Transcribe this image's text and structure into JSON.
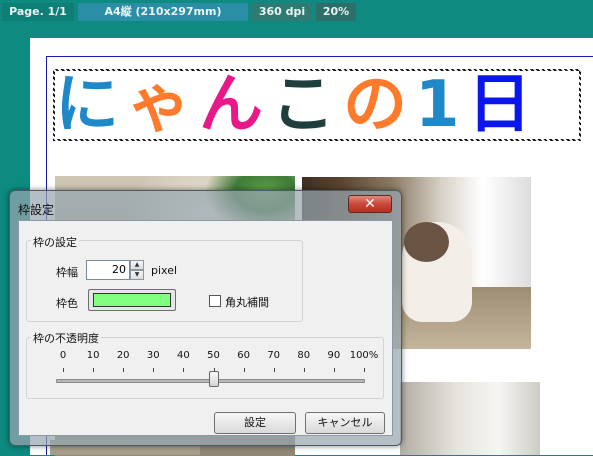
{
  "status_bar": {
    "page": "Page. 1/1",
    "paper": "A4縦 (210x297mm)",
    "dpi": "360 dpi",
    "zoom": "20%"
  },
  "document": {
    "title_chars": [
      {
        "char": "に",
        "color": "#1e88c8"
      },
      {
        "char": "ゃ",
        "color": "#ff7a2a"
      },
      {
        "char": "ん",
        "color": "#e8178a"
      },
      {
        "char": "こ",
        "color": "#1f3f3f"
      },
      {
        "char": "の",
        "color": "#ff7a2a"
      },
      {
        "char": "1",
        "color": "#1e88c8"
      },
      {
        "char": "日",
        "color": "#0b16ee"
      }
    ]
  },
  "dialog": {
    "title": "枠設定",
    "close_label": "✕",
    "frame_group": {
      "label": "枠の設定",
      "width_label": "枠幅",
      "width_value": "20",
      "width_unit": "pixel",
      "color_label": "枠色",
      "color_value": "#80ff80",
      "rounded_label": "角丸補間",
      "rounded_checked": false
    },
    "opacity_group": {
      "label": "枠の不透明度",
      "ticks": [
        "0",
        "10",
        "20",
        "30",
        "40",
        "50",
        "60",
        "70",
        "80",
        "90",
        "100%"
      ],
      "value_percent": 50
    },
    "ok_label": "設定",
    "cancel_label": "キャンセル"
  }
}
